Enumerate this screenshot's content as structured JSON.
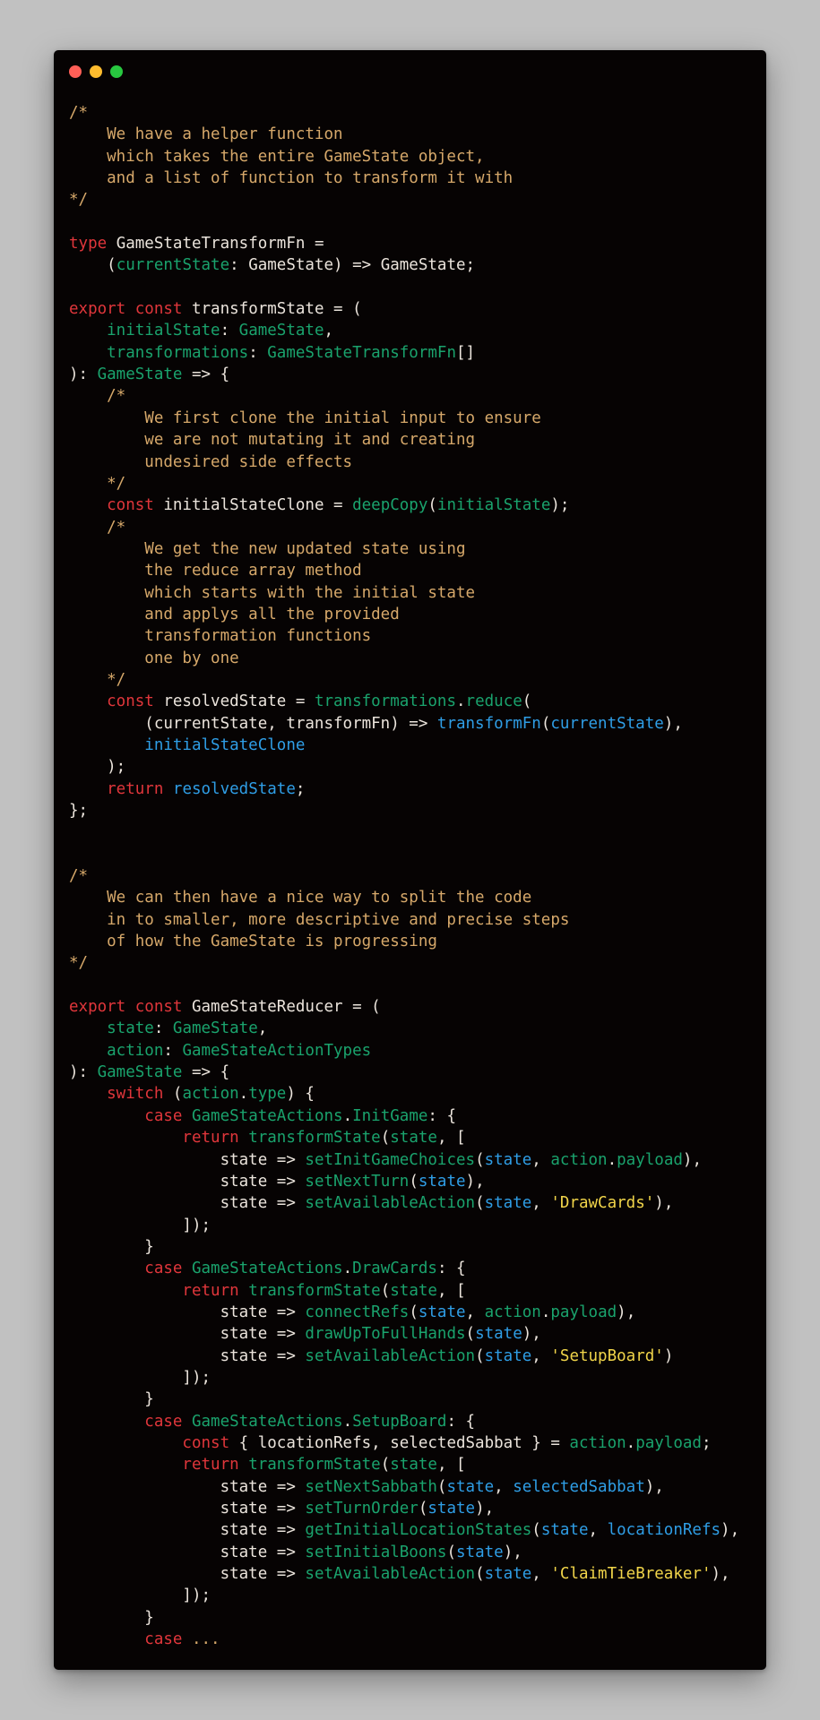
{
  "window": {
    "controls": [
      "close",
      "minimize",
      "maximize"
    ]
  },
  "code_lines": [
    [
      [
        "t-comment",
        "/*"
      ]
    ],
    [
      [
        "t-comment",
        "    We have a helper function"
      ]
    ],
    [
      [
        "t-comment",
        "    which takes the entire GameState object,"
      ]
    ],
    [
      [
        "t-comment",
        "    and a list of function to transform it with"
      ]
    ],
    [
      [
        "t-comment",
        "*/"
      ]
    ],
    [],
    [
      [
        "t-kw",
        "type"
      ],
      [
        "t-plain",
        " GameStateTransformFn ="
      ]
    ],
    [
      [
        "t-plain",
        "    ("
      ],
      [
        "t-type",
        "currentState"
      ],
      [
        "t-plain",
        ": GameState) => GameState;"
      ]
    ],
    [],
    [
      [
        "t-kw",
        "export const"
      ],
      [
        "t-plain",
        " transformState = ("
      ]
    ],
    [
      [
        "t-type",
        "    initialState"
      ],
      [
        "t-plain",
        ": "
      ],
      [
        "t-type",
        "GameState"
      ],
      [
        "t-plain",
        ","
      ]
    ],
    [
      [
        "t-type",
        "    transformations"
      ],
      [
        "t-plain",
        ": "
      ],
      [
        "t-type",
        "GameStateTransformFn"
      ],
      [
        "t-plain",
        "[]"
      ]
    ],
    [
      [
        "t-plain",
        "): "
      ],
      [
        "t-type",
        "GameState"
      ],
      [
        "t-plain",
        " => {"
      ]
    ],
    [
      [
        "t-comment",
        "    /*"
      ]
    ],
    [
      [
        "t-comment",
        "        We first clone the initial input to ensure"
      ]
    ],
    [
      [
        "t-comment",
        "        we are not mutating it and creating"
      ]
    ],
    [
      [
        "t-comment",
        "        undesired side effects"
      ]
    ],
    [
      [
        "t-comment",
        "    */"
      ]
    ],
    [
      [
        "t-kw",
        "    const"
      ],
      [
        "t-plain",
        " initialStateClone = "
      ],
      [
        "t-fn",
        "deepCopy"
      ],
      [
        "t-plain",
        "("
      ],
      [
        "t-type",
        "initialState"
      ],
      [
        "t-plain",
        ");"
      ]
    ],
    [
      [
        "t-comment",
        "    /*"
      ]
    ],
    [
      [
        "t-comment",
        "        We get the new updated state using"
      ]
    ],
    [
      [
        "t-comment",
        "        the reduce array method"
      ]
    ],
    [
      [
        "t-comment",
        "        which starts with the initial state"
      ]
    ],
    [
      [
        "t-comment",
        "        and applys all the provided"
      ]
    ],
    [
      [
        "t-comment",
        "        transformation functions"
      ]
    ],
    [
      [
        "t-comment",
        "        one by one"
      ]
    ],
    [
      [
        "t-comment",
        "    */"
      ]
    ],
    [
      [
        "t-kw",
        "    const"
      ],
      [
        "t-plain",
        " resolvedState = "
      ],
      [
        "t-type",
        "transformations"
      ],
      [
        "t-plain",
        "."
      ],
      [
        "t-fn",
        "reduce"
      ],
      [
        "t-plain",
        "("
      ]
    ],
    [
      [
        "t-plain",
        "        (currentState, transformFn) => "
      ],
      [
        "t-var",
        "transformFn"
      ],
      [
        "t-plain",
        "("
      ],
      [
        "t-var",
        "currentState"
      ],
      [
        "t-plain",
        "),"
      ]
    ],
    [
      [
        "t-var",
        "        initialStateClone"
      ]
    ],
    [
      [
        "t-plain",
        "    );"
      ]
    ],
    [
      [
        "t-kw",
        "    return"
      ],
      [
        "t-plain",
        " "
      ],
      [
        "t-var",
        "resolvedState"
      ],
      [
        "t-plain",
        ";"
      ]
    ],
    [
      [
        "t-plain",
        "};"
      ]
    ],
    [],
    [],
    [
      [
        "t-comment",
        "/*"
      ]
    ],
    [
      [
        "t-comment",
        "    We can then have a nice way to split the code"
      ]
    ],
    [
      [
        "t-comment",
        "    in to smaller, more descriptive and precise steps"
      ]
    ],
    [
      [
        "t-comment",
        "    of how the GameState is progressing"
      ]
    ],
    [
      [
        "t-comment",
        "*/"
      ]
    ],
    [],
    [
      [
        "t-kw",
        "export const"
      ],
      [
        "t-plain",
        " GameStateReducer = ("
      ]
    ],
    [
      [
        "t-type",
        "    state"
      ],
      [
        "t-plain",
        ": "
      ],
      [
        "t-type",
        "GameState"
      ],
      [
        "t-plain",
        ","
      ]
    ],
    [
      [
        "t-type",
        "    action"
      ],
      [
        "t-plain",
        ": "
      ],
      [
        "t-type",
        "GameStateActionTypes"
      ]
    ],
    [
      [
        "t-plain",
        "): "
      ],
      [
        "t-type",
        "GameState"
      ],
      [
        "t-plain",
        " => {"
      ]
    ],
    [
      [
        "t-kw",
        "    switch"
      ],
      [
        "t-plain",
        " ("
      ],
      [
        "t-type",
        "action"
      ],
      [
        "t-plain",
        "."
      ],
      [
        "t-type",
        "type"
      ],
      [
        "t-plain",
        ") {"
      ]
    ],
    [
      [
        "t-kw",
        "        case"
      ],
      [
        "t-plain",
        " "
      ],
      [
        "t-type",
        "GameStateActions"
      ],
      [
        "t-plain",
        "."
      ],
      [
        "t-type",
        "InitGame"
      ],
      [
        "t-plain",
        ": {"
      ]
    ],
    [
      [
        "t-kw",
        "            return"
      ],
      [
        "t-plain",
        " "
      ],
      [
        "t-fn",
        "transformState"
      ],
      [
        "t-plain",
        "("
      ],
      [
        "t-type",
        "state"
      ],
      [
        "t-plain",
        ", ["
      ]
    ],
    [
      [
        "t-plain",
        "                state => "
      ],
      [
        "t-fn",
        "setInitGameChoices"
      ],
      [
        "t-plain",
        "("
      ],
      [
        "t-var",
        "state"
      ],
      [
        "t-plain",
        ", "
      ],
      [
        "t-type",
        "action"
      ],
      [
        "t-plain",
        "."
      ],
      [
        "t-type",
        "payload"
      ],
      [
        "t-plain",
        "),"
      ]
    ],
    [
      [
        "t-plain",
        "                state => "
      ],
      [
        "t-fn",
        "setNextTurn"
      ],
      [
        "t-plain",
        "("
      ],
      [
        "t-var",
        "state"
      ],
      [
        "t-plain",
        "),"
      ]
    ],
    [
      [
        "t-plain",
        "                state => "
      ],
      [
        "t-fn",
        "setAvailableAction"
      ],
      [
        "t-plain",
        "("
      ],
      [
        "t-var",
        "state"
      ],
      [
        "t-plain",
        ", "
      ],
      [
        "t-str",
        "'DrawCards'"
      ],
      [
        "t-plain",
        "),"
      ]
    ],
    [
      [
        "t-plain",
        "            ]);"
      ]
    ],
    [
      [
        "t-plain",
        "        }"
      ]
    ],
    [
      [
        "t-kw",
        "        case"
      ],
      [
        "t-plain",
        " "
      ],
      [
        "t-type",
        "GameStateActions"
      ],
      [
        "t-plain",
        "."
      ],
      [
        "t-type",
        "DrawCards"
      ],
      [
        "t-plain",
        ": {"
      ]
    ],
    [
      [
        "t-kw",
        "            return"
      ],
      [
        "t-plain",
        " "
      ],
      [
        "t-fn",
        "transformState"
      ],
      [
        "t-plain",
        "("
      ],
      [
        "t-type",
        "state"
      ],
      [
        "t-plain",
        ", ["
      ]
    ],
    [
      [
        "t-plain",
        "                state => "
      ],
      [
        "t-fn",
        "connectRefs"
      ],
      [
        "t-plain",
        "("
      ],
      [
        "t-var",
        "state"
      ],
      [
        "t-plain",
        ", "
      ],
      [
        "t-type",
        "action"
      ],
      [
        "t-plain",
        "."
      ],
      [
        "t-type",
        "payload"
      ],
      [
        "t-plain",
        "),"
      ]
    ],
    [
      [
        "t-plain",
        "                state => "
      ],
      [
        "t-fn",
        "drawUpToFullHands"
      ],
      [
        "t-plain",
        "("
      ],
      [
        "t-var",
        "state"
      ],
      [
        "t-plain",
        "),"
      ]
    ],
    [
      [
        "t-plain",
        "                state => "
      ],
      [
        "t-fn",
        "setAvailableAction"
      ],
      [
        "t-plain",
        "("
      ],
      [
        "t-var",
        "state"
      ],
      [
        "t-plain",
        ", "
      ],
      [
        "t-str",
        "'SetupBoard'"
      ],
      [
        "t-plain",
        ")"
      ]
    ],
    [
      [
        "t-plain",
        "            ]);"
      ]
    ],
    [
      [
        "t-plain",
        "        }"
      ]
    ],
    [
      [
        "t-kw",
        "        case"
      ],
      [
        "t-plain",
        " "
      ],
      [
        "t-type",
        "GameStateActions"
      ],
      [
        "t-plain",
        "."
      ],
      [
        "t-type",
        "SetupBoard"
      ],
      [
        "t-plain",
        ": {"
      ]
    ],
    [
      [
        "t-kw",
        "            const"
      ],
      [
        "t-plain",
        " { locationRefs, selectedSabbat } = "
      ],
      [
        "t-type",
        "action"
      ],
      [
        "t-plain",
        "."
      ],
      [
        "t-type",
        "payload"
      ],
      [
        "t-plain",
        ";"
      ]
    ],
    [
      [
        "t-kw",
        "            return"
      ],
      [
        "t-plain",
        " "
      ],
      [
        "t-fn",
        "transformState"
      ],
      [
        "t-plain",
        "("
      ],
      [
        "t-type",
        "state"
      ],
      [
        "t-plain",
        ", ["
      ]
    ],
    [
      [
        "t-plain",
        "                state => "
      ],
      [
        "t-fn",
        "setNextSabbath"
      ],
      [
        "t-plain",
        "("
      ],
      [
        "t-var",
        "state"
      ],
      [
        "t-plain",
        ", "
      ],
      [
        "t-var",
        "selectedSabbat"
      ],
      [
        "t-plain",
        "),"
      ]
    ],
    [
      [
        "t-plain",
        "                state => "
      ],
      [
        "t-fn",
        "setTurnOrder"
      ],
      [
        "t-plain",
        "("
      ],
      [
        "t-var",
        "state"
      ],
      [
        "t-plain",
        "),"
      ]
    ],
    [
      [
        "t-plain",
        "                state => "
      ],
      [
        "t-fn",
        "getInitialLocationStates"
      ],
      [
        "t-plain",
        "("
      ],
      [
        "t-var",
        "state"
      ],
      [
        "t-plain",
        ", "
      ],
      [
        "t-var",
        "locationRefs"
      ],
      [
        "t-plain",
        "),"
      ]
    ],
    [
      [
        "t-plain",
        "                state => "
      ],
      [
        "t-fn",
        "setInitialBoons"
      ],
      [
        "t-plain",
        "("
      ],
      [
        "t-var",
        "state"
      ],
      [
        "t-plain",
        "),"
      ]
    ],
    [
      [
        "t-plain",
        "                state => "
      ],
      [
        "t-fn",
        "setAvailableAction"
      ],
      [
        "t-plain",
        "("
      ],
      [
        "t-var",
        "state"
      ],
      [
        "t-plain",
        ", "
      ],
      [
        "t-str",
        "'ClaimTieBreaker'"
      ],
      [
        "t-plain",
        "),"
      ]
    ],
    [
      [
        "t-plain",
        "            ]);"
      ]
    ],
    [
      [
        "t-plain",
        "        }"
      ]
    ],
    [
      [
        "t-kw",
        "        case"
      ],
      [
        "t-plain",
        " "
      ],
      [
        "t-comment",
        "..."
      ]
    ]
  ]
}
